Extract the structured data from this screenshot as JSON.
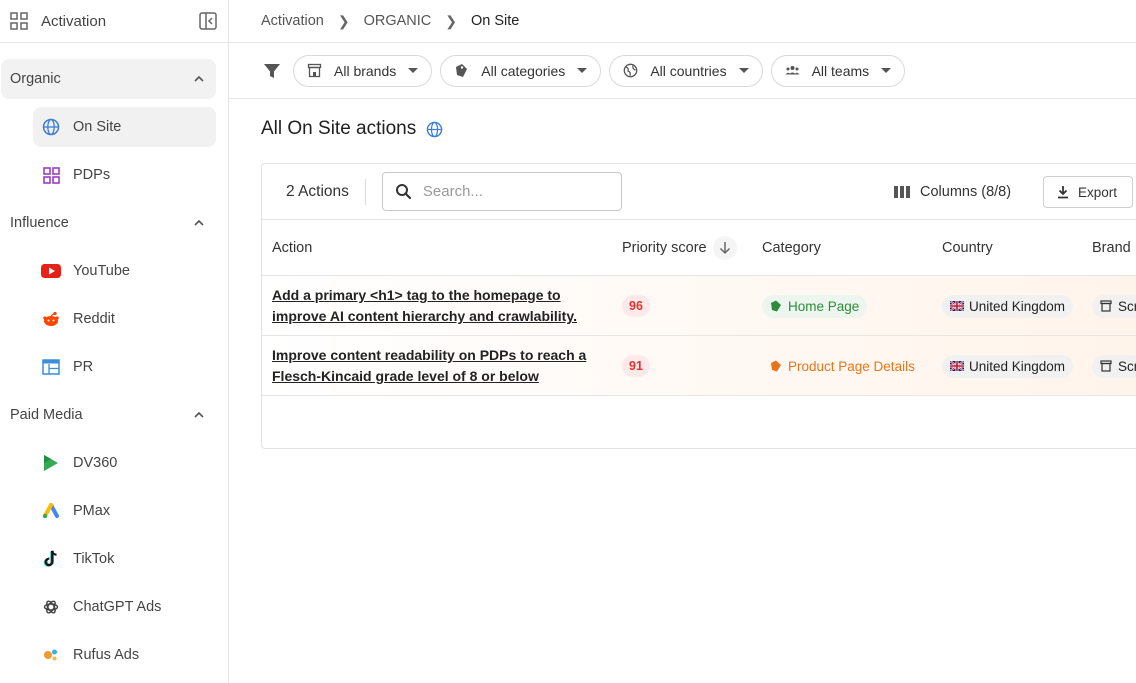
{
  "sidebar": {
    "title": "Activation",
    "sections": [
      {
        "label": "Organic",
        "items": [
          {
            "label": "On Site",
            "icon": "globe-icon"
          },
          {
            "label": "PDPs",
            "icon": "grid-icon"
          }
        ]
      },
      {
        "label": "Influence",
        "items": [
          {
            "label": "YouTube",
            "icon": "youtube-icon"
          },
          {
            "label": "Reddit",
            "icon": "reddit-icon"
          },
          {
            "label": "PR",
            "icon": "newspaper-icon"
          }
        ]
      },
      {
        "label": "Paid Media",
        "items": [
          {
            "label": "DV360",
            "icon": "dv360-icon"
          },
          {
            "label": "PMax",
            "icon": "google-ads-icon"
          },
          {
            "label": "TikTok",
            "icon": "tiktok-icon"
          },
          {
            "label": "ChatGPT Ads",
            "icon": "openai-icon"
          },
          {
            "label": "Rufus Ads",
            "icon": "rufus-icon"
          }
        ]
      }
    ]
  },
  "breadcrumb": {
    "items": [
      "Activation",
      "ORGANIC",
      "On Site"
    ]
  },
  "filters": {
    "brands": "All brands",
    "categories": "All categories",
    "countries": "All countries",
    "teams": "All teams"
  },
  "page": {
    "title": "All On Site actions"
  },
  "table": {
    "count_label": "2 Actions",
    "search_placeholder": "Search...",
    "columns_label": "Columns (8/8)",
    "export_label": "Export",
    "headers": {
      "action": "Action",
      "priority": "Priority score",
      "category": "Category",
      "country": "Country",
      "brand": "Brand"
    },
    "rows": [
      {
        "action": "Add a primary <h1> tag to the homepage to improve AI content hierarchy and crawlability.",
        "priority": "96",
        "category": "Home Page",
        "country": "United Kingdom",
        "brand": "Scr"
      },
      {
        "action": "Improve content readability on PDPs to reach a Flesch-Kincaid grade level of 8 or below",
        "priority": "91",
        "category": "Product Page Details",
        "country": "United Kingdom",
        "brand": "Scr"
      }
    ]
  },
  "colors": {
    "accent_blue": "#3b7ddd",
    "score_red": "#dd3333",
    "category_green": "#2e8b3a",
    "category_orange": "#e8751a"
  }
}
